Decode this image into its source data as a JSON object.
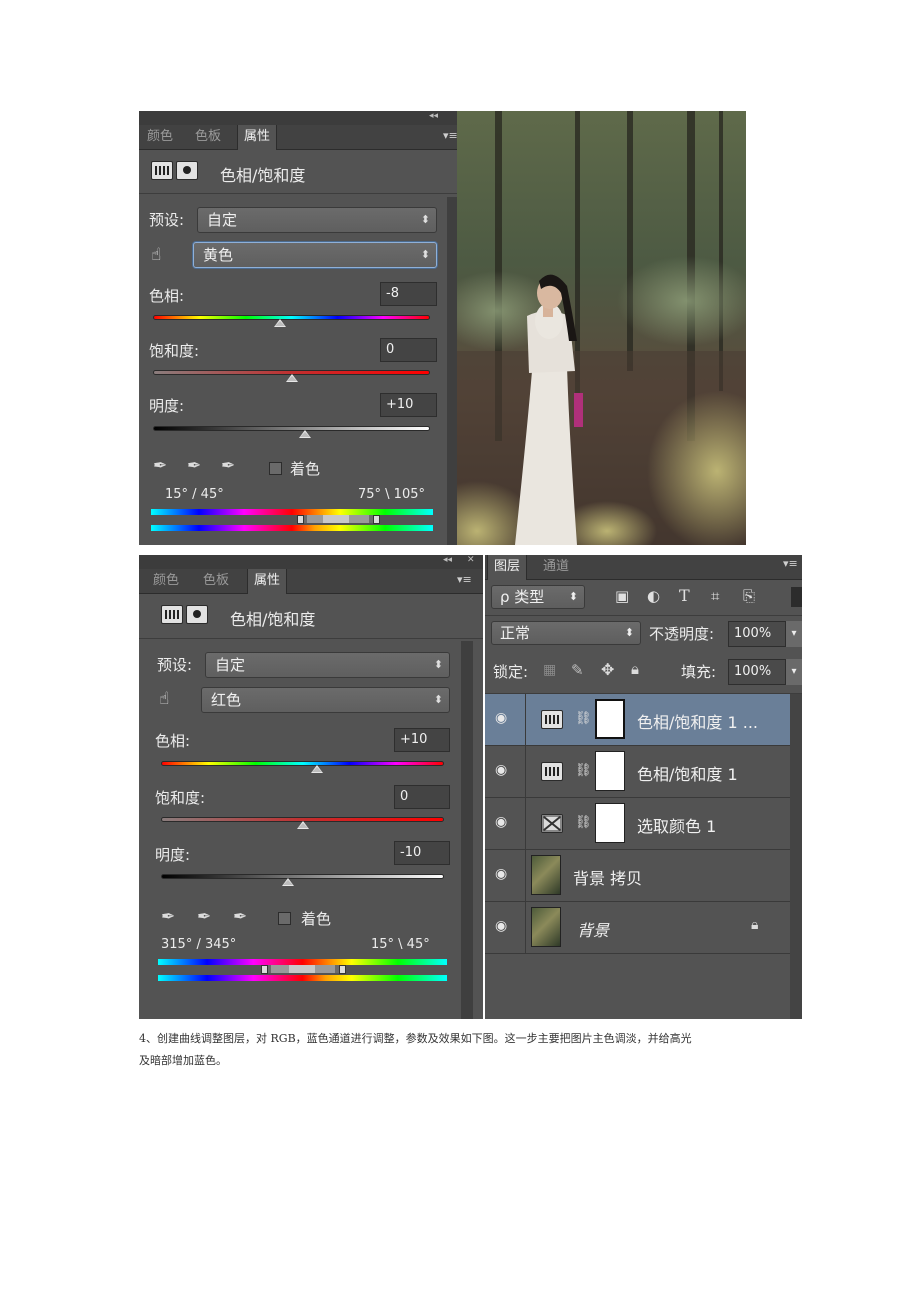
{
  "panel1": {
    "tabs": [
      "颜色",
      "色板",
      "属性"
    ],
    "title": "色相/饱和度",
    "preset_label": "预设:",
    "preset_value": "自定",
    "channel_value": "黄色",
    "hue_label": "色相:",
    "hue_value": "-8",
    "hue_level": 0.46,
    "sat_label": "饱和度:",
    "sat_value": "0",
    "sat_level": 0.5,
    "lit_label": "明度:",
    "lit_value": "+10",
    "lit_level": 0.55,
    "colorize_label": "着色",
    "range_left": "15° / 45°",
    "range_right": "75° \\ 105°"
  },
  "panel2": {
    "tabs": [
      "颜色",
      "色板",
      "属性"
    ],
    "title": "色相/饱和度",
    "preset_label": "预设:",
    "preset_value": "自定",
    "channel_value": "红色",
    "hue_label": "色相:",
    "hue_value": "+10",
    "hue_level": 0.55,
    "sat_label": "饱和度:",
    "sat_value": "0",
    "sat_level": 0.5,
    "lit_label": "明度:",
    "lit_value": "-10",
    "lit_level": 0.45,
    "colorize_label": "着色",
    "range_left": "315° / 345°",
    "range_right": "15° \\ 45°"
  },
  "layers": {
    "tabs": [
      "图层",
      "通道"
    ],
    "filter_label": "ρ 类型",
    "blend_mode": "正常",
    "opacity_label": "不透明度:",
    "opacity_value": "100%",
    "lock_label": "锁定:",
    "fill_label": "填充:",
    "fill_value": "100%",
    "rows": [
      {
        "name": "色相/饱和度 1 ..."
      },
      {
        "name": "色相/饱和度 1"
      },
      {
        "name": "选取颜色 1"
      },
      {
        "name": "背景 拷贝"
      },
      {
        "name": "背景"
      }
    ]
  },
  "caption": {
    "line1": "4、创建曲线调整图层，对 RGB，蓝色通道进行调整，参数及效果如下图。这一步主要把图片主色调淡，并给高光",
    "line2": "及暗部增加蓝色。"
  },
  "icons": {
    "eye": "eye-icon",
    "chain": "link-icon",
    "lock": "lock-icon",
    "eyedropper": "eyedropper-icon",
    "hand": "targeted-adjustment-hand-icon"
  }
}
